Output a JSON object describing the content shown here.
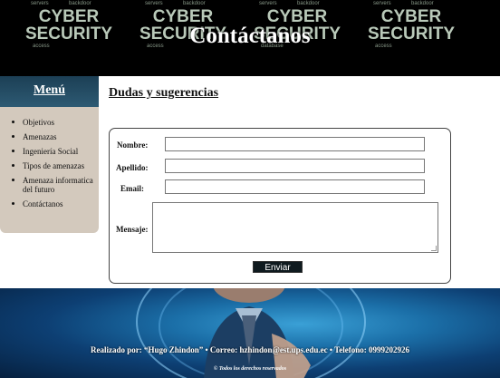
{
  "header": {
    "title": "Contáctanos",
    "banner": {
      "word_top": "CYBER",
      "word_bottom": "SECURITY",
      "small_words": [
        "servers",
        "backdoor",
        "access",
        "database"
      ]
    }
  },
  "sidebar": {
    "title": "Menú",
    "items": [
      {
        "label": "Objetivos"
      },
      {
        "label": "Amenazas"
      },
      {
        "label": "Ingeniería Social"
      },
      {
        "label": "Tipos de amenazas"
      },
      {
        "label": "Amenaza informatica del futuro"
      },
      {
        "label": "Contáctanos"
      }
    ]
  },
  "main": {
    "title": "Dudas y sugerencias",
    "form": {
      "nombre_label": "Nombre:",
      "nombre_value": "",
      "apellido_label": "Apellido:",
      "apellido_value": "",
      "email_label": "Email:",
      "email_value": "",
      "mensaje_label": "Mensaje:",
      "mensaje_value": "",
      "submit_label": "Enviar"
    }
  },
  "footer": {
    "credits": "Realizado por: “Hugo Zhindon” • Correo: hzhindon@est.ups.edu.ec • Telefono: 0999202926",
    "copyright": "© Todos los derechos reservados"
  },
  "colors": {
    "sidebar_bg": "#d3c9bd",
    "sidebar_header": "#1c3f55",
    "footer_accent": "#1b6fa8",
    "button_bg": "#0f1a1f"
  }
}
